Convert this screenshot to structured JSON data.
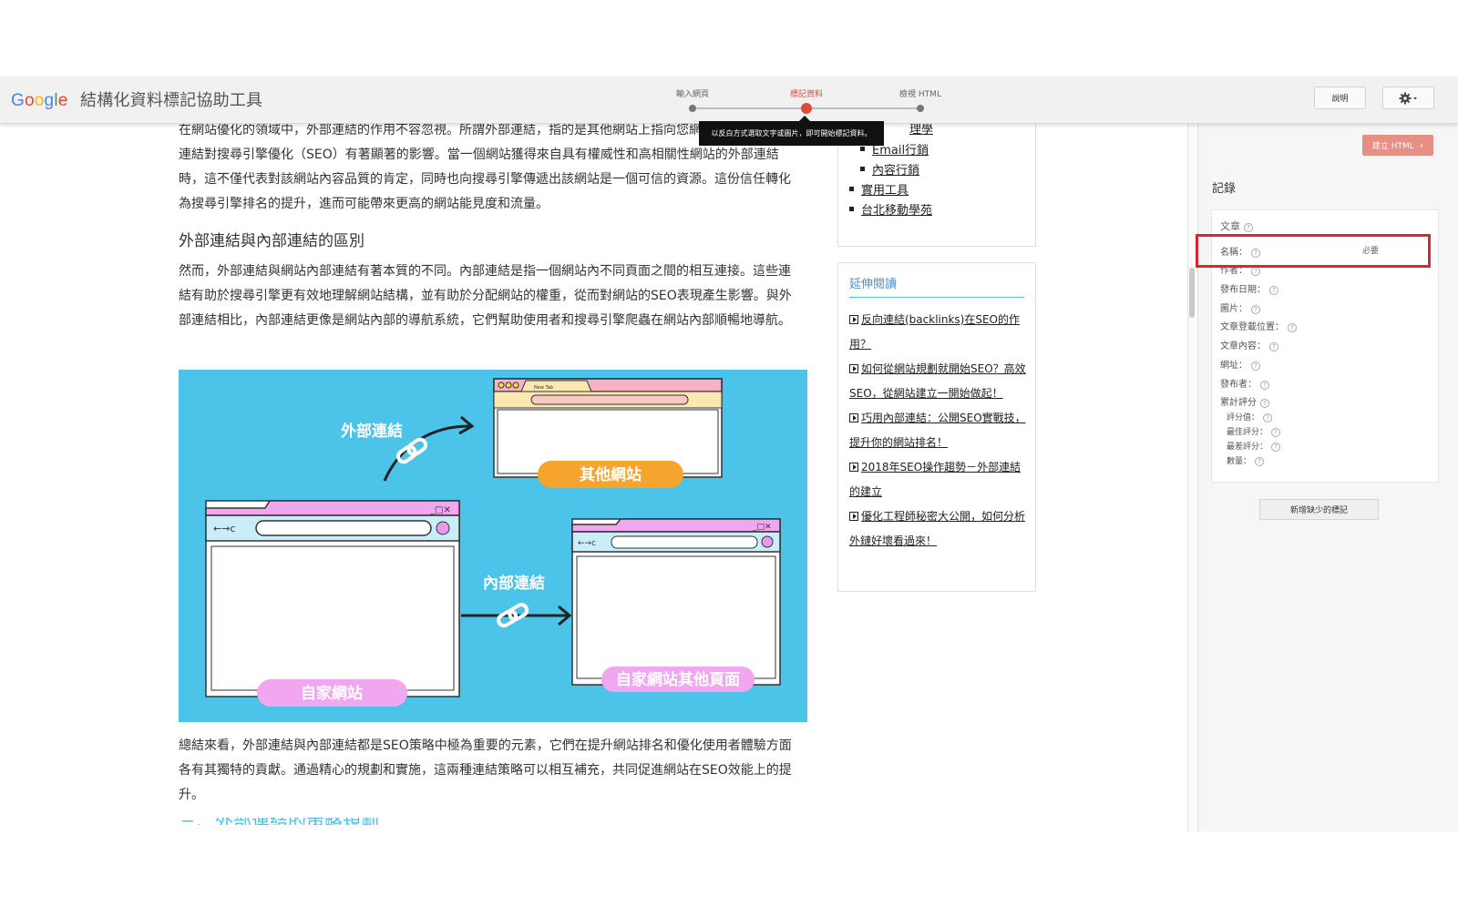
{
  "app": {
    "logo_letters": [
      {
        "ch": "G",
        "color": "#4285f4"
      },
      {
        "ch": "o",
        "color": "#ea4335"
      },
      {
        "ch": "o",
        "color": "#fbbc05"
      },
      {
        "ch": "g",
        "color": "#4285f4"
      },
      {
        "ch": "l",
        "color": "#34a853"
      },
      {
        "ch": "e",
        "color": "#ea4335"
      }
    ],
    "title": "結構化資料標記協助工具"
  },
  "steps": [
    {
      "label": "輸入網頁",
      "active": false
    },
    {
      "label": "標記資料",
      "active": true
    },
    {
      "label": "檢視 HTML",
      "active": false
    }
  ],
  "toolbar": {
    "help_label": "說明",
    "settings_icon": "gear-icon",
    "tooltip": "以反白方式選取文字或圖片，即可開始標記資料。"
  },
  "article": {
    "para1": "在網站優化的領域中，外部連結的作用不容忽視。所謂外部連結，指的是其他網站上指向您網站的連結。這些連結對搜尋引擎優化（SEO）有著顯著的影響。當一個網站獲得來自具有權威性和高相關性網站的外部連結時，這不僅代表對該網站內容品質的肯定，同時也向搜尋引擎傳遞出該網站是一個可信的資源。這份信任轉化為搜尋引擎排名的提升，進而可能帶來更高的網站能見度和流量。",
    "heading": "外部連結與內部連結的區別",
    "para2": "然而，外部連結與網站內部連結有著本質的不同。內部連結是指一個網站內不同頁面之間的相互連接。這些連結有助於搜尋引擎更有效地理解網站結構，並有助於分配網站的權重，從而對網站的SEO表現產生影響。與外部連結相比，內部連結更像是網站內部的導航系統，它們幫助使用者和搜尋引擎爬蟲在網站內部順暢地導航。",
    "para3": "總結來看，外部連結與內部連結都是SEO策略中極為重要的元素，它們在提升網站排名和優化使用者體驗方面各有其獨特的貢獻。通過精心的規劃和實施，這兩種連結策略可以相互補充，共同促進網站在SEO效能上的提升。",
    "next_heading": "三、外部連結的策略規劃"
  },
  "figure": {
    "external_link": "外部連結",
    "other_site": "其他網站",
    "internal_link": "內部連結",
    "own_site": "自家網站",
    "own_site_other_page": "自家網站其他頁面",
    "tab_text": "New Tab"
  },
  "sidebar": {
    "menu": {
      "item_top_partial": "理學",
      "sub_items": [
        "Email行銷",
        "內容行銷"
      ],
      "items": [
        "實用工具",
        "台北移動學苑"
      ]
    },
    "reading": {
      "title": "延伸閱讀",
      "links": [
        "反向連結(backlinks)在SEO的作用？",
        "如何從網站規劃就開始SEO？高效SEO，從網站建立一開始做起！",
        "巧用內部連結：公開SEO實戰技，提升你的網站排名！",
        "2018年SEO操作趨勢－外部連結的建立",
        "優化工程師秘密大公開，如何分析外鏈好壞看過來！"
      ]
    }
  },
  "panel": {
    "create_html": "建立 HTML",
    "records_title": "記錄",
    "type": "文章",
    "fields": [
      {
        "label": "名稱：",
        "required": "必要"
      },
      {
        "label": "作者："
      },
      {
        "label": "發布日期："
      },
      {
        "label": "圖片："
      },
      {
        "label": "文章登載位置："
      },
      {
        "label": "文章內容："
      },
      {
        "label": "網址："
      },
      {
        "label": "發布者："
      },
      {
        "label": "累計評分"
      }
    ],
    "rating_fields": [
      "評分值：",
      "最佳評分：",
      "最差評分：",
      "數量："
    ],
    "add_missing": "新增缺少的標記"
  }
}
